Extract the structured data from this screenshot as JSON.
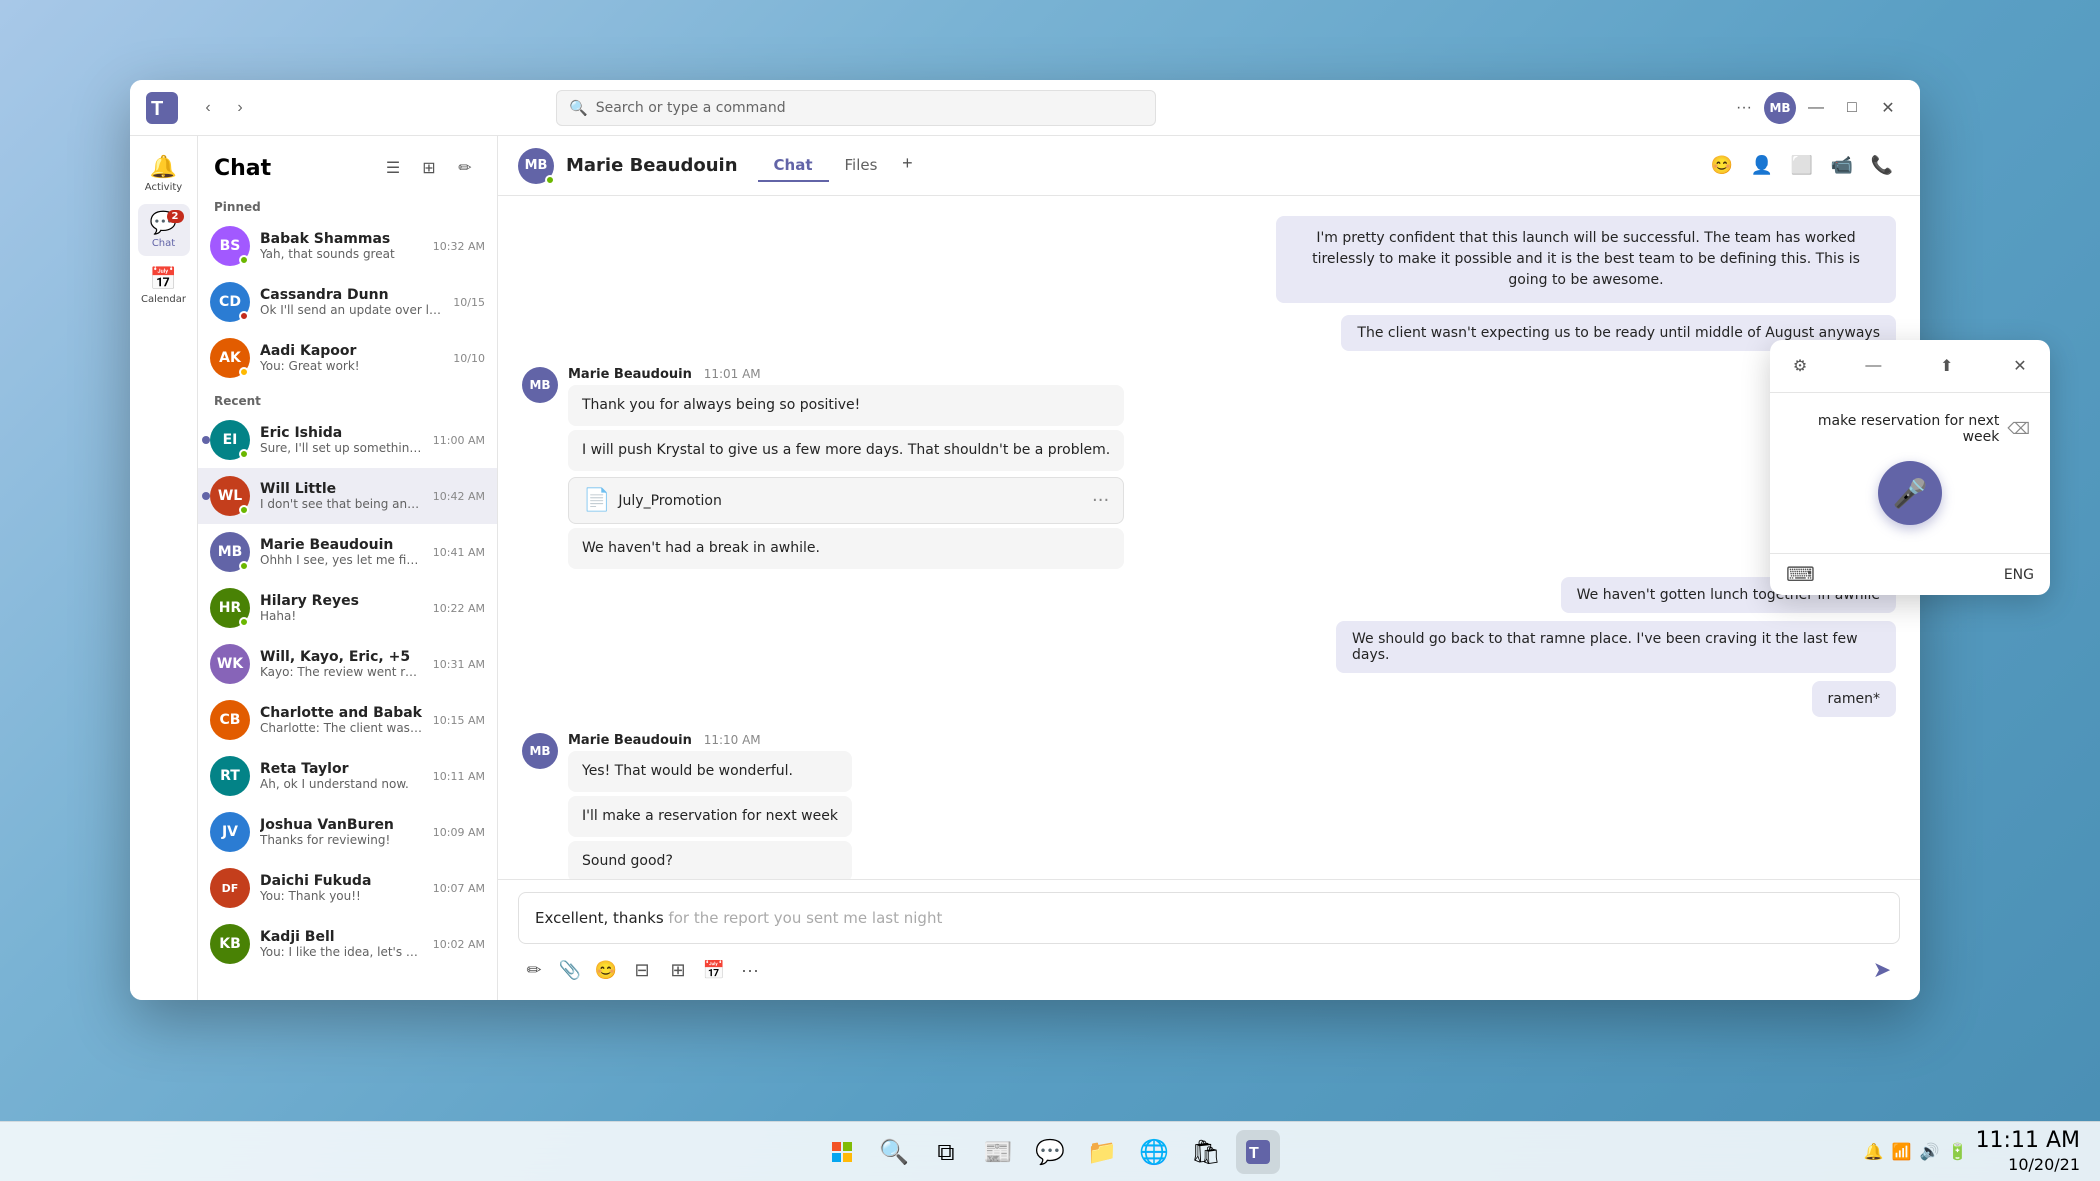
{
  "window": {
    "title": "Microsoft Teams",
    "search_placeholder": "Search or type a command"
  },
  "titlebar": {
    "more_label": "···",
    "minimize_label": "—",
    "maximize_label": "□",
    "close_label": "✕",
    "user_initials": "MB"
  },
  "sidebar": {
    "items": [
      {
        "id": "activity",
        "label": "Activity",
        "icon": "🔔",
        "badge": null
      },
      {
        "id": "chat",
        "label": "Chat",
        "icon": "💬",
        "badge": "2",
        "active": true
      },
      {
        "id": "calendar",
        "label": "Calendar",
        "icon": "📅",
        "badge": null
      }
    ]
  },
  "chat_list": {
    "title": "Chat",
    "pinned_label": "Pinned",
    "recent_label": "Recent",
    "items": [
      {
        "id": "babak",
        "name": "Babak Shammas",
        "preview": "Yah, that sounds great",
        "time": "10:32 AM",
        "color": "#a259ff",
        "initials": "BS",
        "status": "online",
        "pinned": true
      },
      {
        "id": "cassandra",
        "name": "Cassandra Dunn",
        "preview": "Ok I'll send an update over later",
        "time": "10/15",
        "color": "#2b7cd3",
        "initials": "CD",
        "status": "busy",
        "pinned": true
      },
      {
        "id": "aadi",
        "name": "Aadi Kapoor",
        "preview": "You: Great work!",
        "time": "10/10",
        "color": "#e25c00",
        "initials": "AK",
        "status": "away",
        "pinned": true
      },
      {
        "id": "eric",
        "name": "Eric Ishida",
        "preview": "Sure, I'll set up something for next week to...",
        "time": "11:00 AM",
        "color": "#038387",
        "initials": "EI",
        "status": "online",
        "unread": true
      },
      {
        "id": "will",
        "name": "Will Little",
        "preview": "I don't see that being an issue, can take t...",
        "time": "10:42 AM",
        "color": "#c43e1c",
        "initials": "WL",
        "status": "online",
        "active": true,
        "unread": true
      },
      {
        "id": "marie",
        "name": "Marie Beaudouin",
        "preview": "Ohhh I see, yes let me fix that!",
        "time": "10:41 AM",
        "color": "#6264a7",
        "initials": "MB",
        "status": "online"
      },
      {
        "id": "hilary",
        "name": "Hilary Reyes",
        "preview": "Haha!",
        "time": "10:22 AM",
        "color": "#498205",
        "initials": "HR",
        "status": "online"
      },
      {
        "id": "will_group",
        "name": "Will, Kayo, Eric, +5",
        "preview": "Kayo: The review went really well!",
        "time": "10:31 AM",
        "color": "#8764b8",
        "initials": "WK"
      },
      {
        "id": "charlotte",
        "name": "Charlotte and Babak",
        "preview": "Charlotte: The client was pretty happy with...",
        "time": "10:15 AM",
        "color": "#e25c00",
        "initials": "CB"
      },
      {
        "id": "reta",
        "name": "Reta Taylor",
        "preview": "Ah, ok I understand now.",
        "time": "10:11 AM",
        "color": "#038387",
        "initials": "RT"
      },
      {
        "id": "joshua",
        "name": "Joshua VanBuren",
        "preview": "Thanks for reviewing!",
        "time": "10:09 AM",
        "color": "#2b7cd3",
        "initials": "JV"
      },
      {
        "id": "daichi",
        "name": "Daichi Fukuda",
        "preview": "You: Thank you!!",
        "time": "10:07 AM",
        "color": "#c43e1c",
        "initials": "DF"
      },
      {
        "id": "kadji",
        "name": "Kadji Bell",
        "preview": "You: I like the idea, let's pitch it!",
        "time": "10:02 AM",
        "color": "#498205",
        "initials": "KB"
      }
    ]
  },
  "chat_main": {
    "contact_name": "Marie Beaudouin",
    "contact_initials": "MB",
    "contact_color": "#6264a7",
    "tabs": [
      {
        "id": "chat",
        "label": "Chat",
        "active": true
      },
      {
        "id": "files",
        "label": "Files"
      }
    ],
    "add_tab_label": "+",
    "messages": [
      {
        "id": "msg1",
        "type": "right",
        "text": "I'm pretty confident that this launch will be successful. The team has worked tirelessly to make it possible and it is the best team to be defining this. This is going to be awesome."
      },
      {
        "id": "msg2",
        "type": "right",
        "text": "The client wasn't expecting us to be ready until middle of August anyways"
      },
      {
        "id": "msg3",
        "type": "left",
        "sender": "Marie Beaudouin",
        "time": "11:01 AM",
        "initials": "MB",
        "color": "#6264a7",
        "texts": [
          "Thank you for always being so positive!",
          "I will push Krystal to give us a few more days. That shouldn't be a problem."
        ],
        "file": {
          "name": "July_Promotion",
          "icon": "📄"
        },
        "extra_text": "We haven't had a break in awhile."
      },
      {
        "id": "msg4",
        "type": "right",
        "text": "We haven't gotten lunch together in awhile"
      },
      {
        "id": "msg5",
        "type": "right",
        "text": "We should go back to that ramne place. I've been craving it the last few days."
      },
      {
        "id": "msg6",
        "type": "right",
        "text": "ramen*"
      },
      {
        "id": "msg7",
        "type": "left",
        "sender": "Marie Beaudouin",
        "time": "11:10 AM",
        "initials": "MB",
        "color": "#6264a7",
        "texts": [
          "Yes! That would be wonderful.",
          "I'll make a reservation for next week",
          "Sound good?"
        ]
      }
    ],
    "input": {
      "typed": "Excellent, thanks",
      "suggestion": " for the report you sent me last night"
    }
  },
  "voice_popup": {
    "voice_text": "make reservation for next week",
    "lang": "ENG"
  },
  "taskbar": {
    "time": "11:11 AM",
    "date": "10/20/21",
    "icons": [
      {
        "id": "start",
        "symbol": "⊞"
      },
      {
        "id": "search",
        "symbol": "🔍"
      },
      {
        "id": "task-view",
        "symbol": "⧉"
      },
      {
        "id": "widgets",
        "symbol": "⊡"
      },
      {
        "id": "chat",
        "symbol": "💬"
      },
      {
        "id": "explorer",
        "symbol": "📁"
      },
      {
        "id": "edge",
        "symbol": "🌐"
      },
      {
        "id": "store",
        "symbol": "🛍"
      },
      {
        "id": "teams-taskbar",
        "symbol": "👥",
        "active": true
      }
    ]
  }
}
